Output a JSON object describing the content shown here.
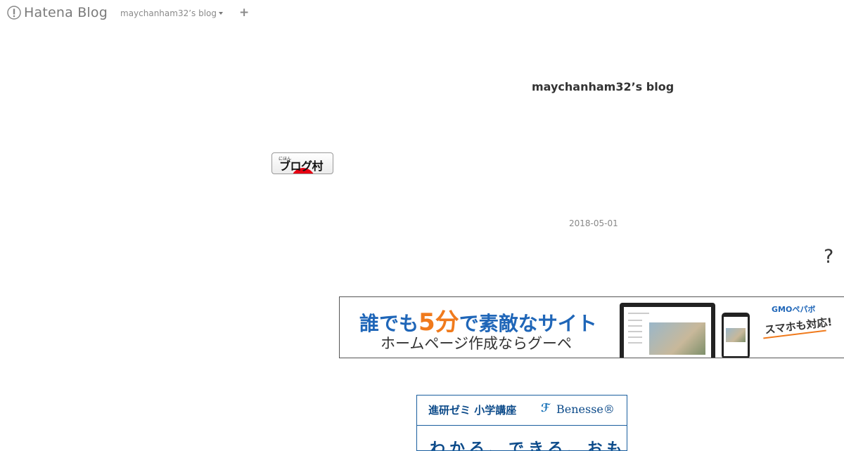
{
  "header": {
    "logo_text": "Hatena Blog",
    "blog_name": "maychanham32’s blog",
    "add_label": "+"
  },
  "blog": {
    "title": "maychanham32’s blog",
    "date": "2018-05-01",
    "help_mark": "?"
  },
  "badge": {
    "small_text": "にほん",
    "text": "ブログ村"
  },
  "ad_goope": {
    "headline_before": "誰でも",
    "headline_highlight": "5分",
    "headline_after": "で素敵なサイト",
    "subline": "ホームページ作成ならグーペ",
    "brand": "GMOペパボ",
    "mobile_note": "スマホも対応!"
  },
  "ad_benesse": {
    "title": "進研ゼミ 小学講座",
    "brand": "Benesse®",
    "body_partial": "わかる、できる、おもしろい"
  },
  "colors": {
    "accent_blue": "#1f66b8",
    "accent_orange": "#f07a1c",
    "benesse_blue": "#0d4b8a"
  }
}
